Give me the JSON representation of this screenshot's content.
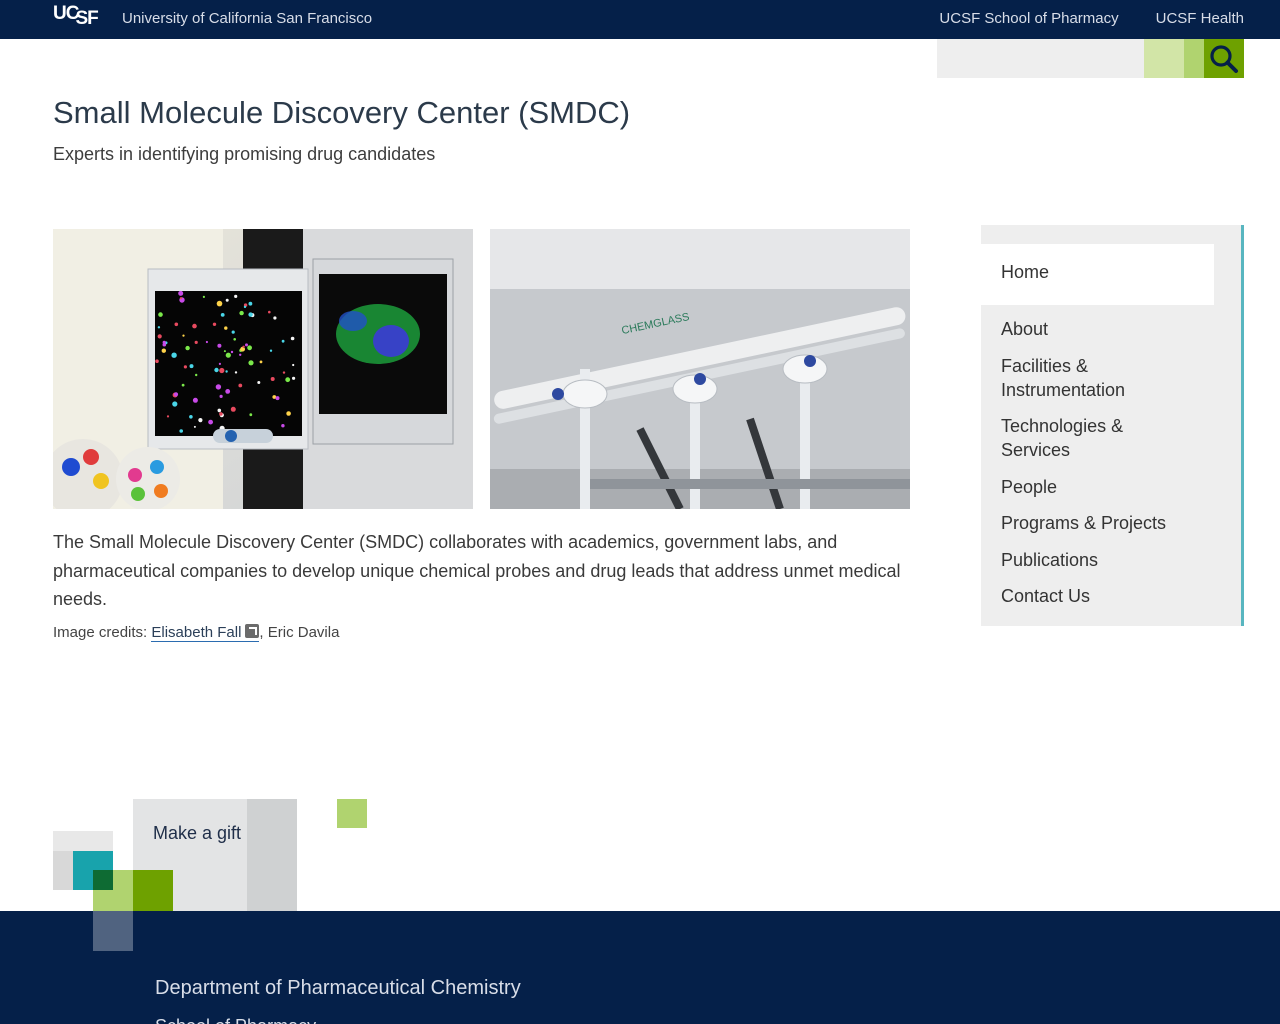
{
  "topbar": {
    "logo_top": "UC",
    "logo_bottom": "SF",
    "university": "University of California San Francisco",
    "links": [
      "UCSF School of Pharmacy",
      "UCSF Health"
    ]
  },
  "search": {
    "placeholder": ""
  },
  "header": {
    "title": "Small Molecule Discovery Center (SMDC)",
    "tagline": "Experts in identifying promising drug candidates"
  },
  "main": {
    "body": "The Small Molecule Discovery Center (SMDC) collaborates with academics, government labs, and pharmaceutical companies to develop unique chemical probes and drug leads that address unmet medical needs.",
    "credits_prefix": "Image credits: ",
    "credit_link": "Elisabeth Fall",
    "credit_rest": ", Eric Davila",
    "image2_text": "CHEMGLASS"
  },
  "sidebar": {
    "home": "Home",
    "items": [
      "About",
      "Facilities & Instrumentation",
      "Technologies & Services",
      "People",
      "Programs & Projects",
      "Publications",
      "Contact Us"
    ]
  },
  "gift": {
    "label": "Make a gift"
  },
  "footer": {
    "title": "Department of Pharmaceutical Chemistry",
    "subtitle": "School of Pharmacy"
  },
  "colors": {
    "navy": "#052049",
    "green": "#6ea100",
    "teal": "#18a3ac",
    "nav_border": "#58b6c0"
  }
}
